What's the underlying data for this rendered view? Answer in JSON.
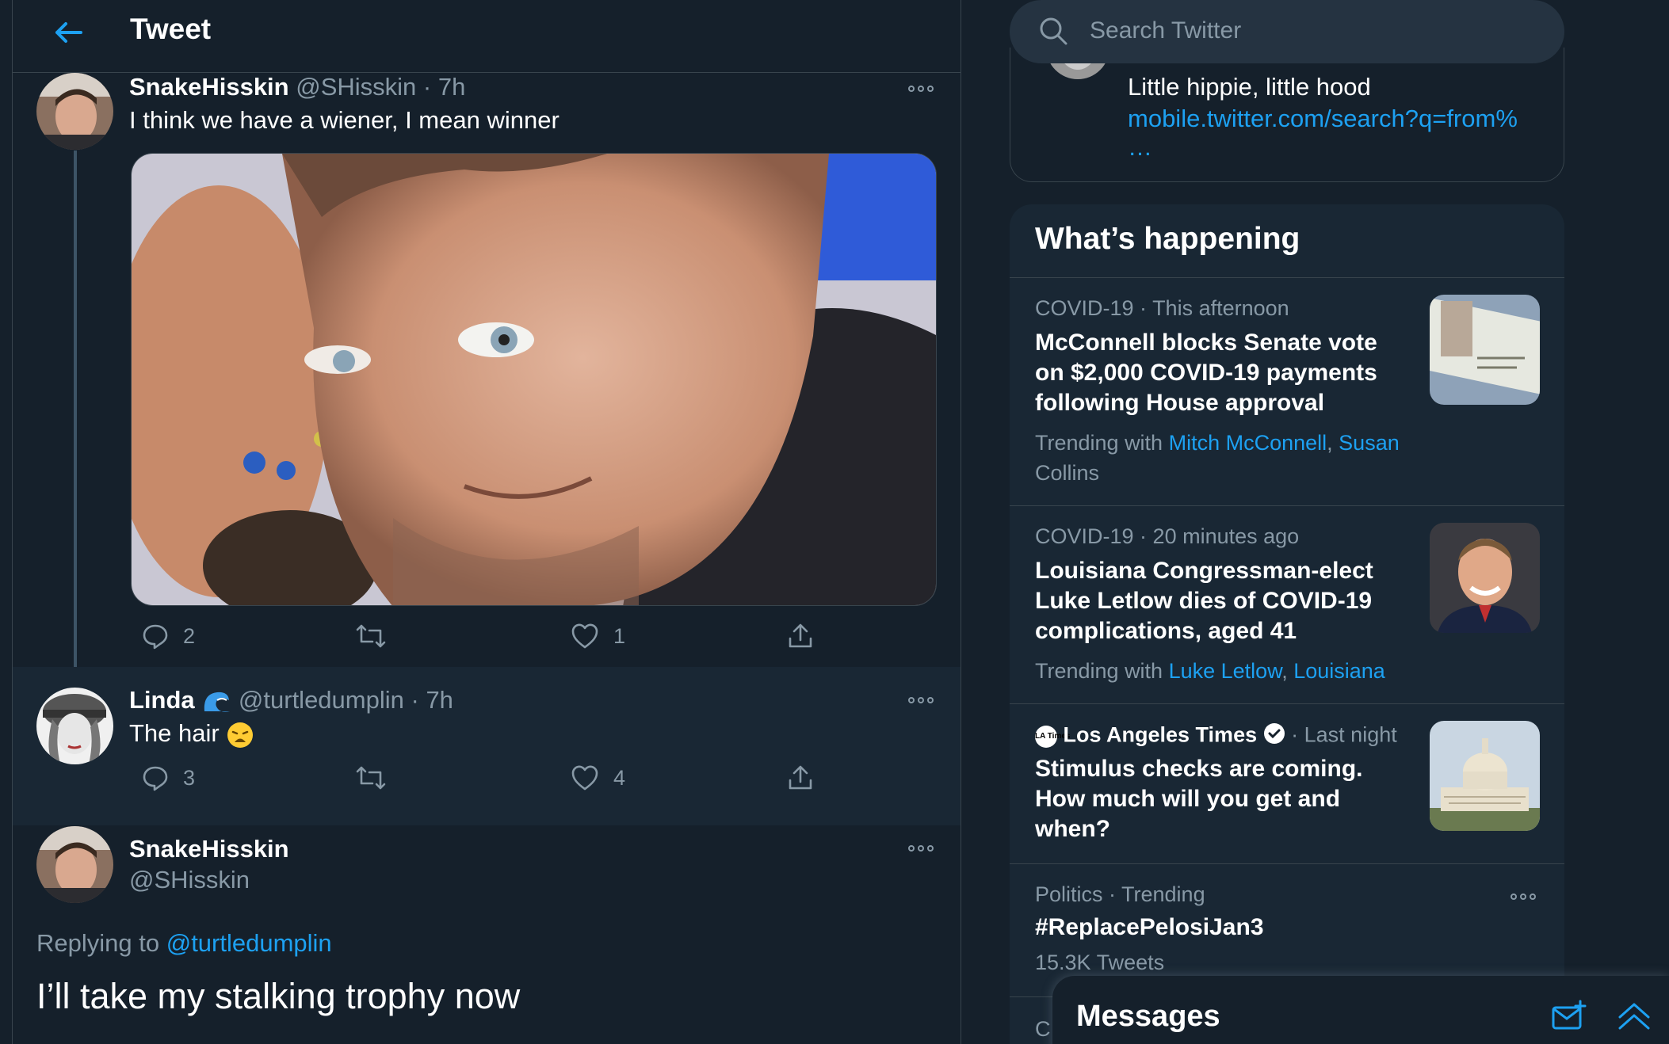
{
  "header": {
    "title": "Tweet"
  },
  "tweets": [
    {
      "name": "SnakeHisskin",
      "handle": "@SHisskin",
      "time": "7h",
      "text": "I think we have a wiener, I mean winner",
      "replies": "2",
      "likes": "1"
    },
    {
      "name": "Linda",
      "handle": "@turtledumplin",
      "time": "7h",
      "text": "The hair",
      "replies": "3",
      "likes": "4"
    }
  ],
  "main_tweet": {
    "name": "SnakeHisskin",
    "handle": "@SHisskin",
    "replying_prefix": "Replying to",
    "replying_to": "@turtledumplin",
    "text": "I’ll take my stalking trophy now"
  },
  "sep": " · ",
  "search": {
    "placeholder": "Search Twitter"
  },
  "prev_card": {
    "text": "Little hippie, little hood",
    "link": "mobile.twitter.com/search?q=from%",
    "ellipsis": "…"
  },
  "whats_happening": {
    "title": "What’s happening",
    "items": [
      {
        "category": "COVID-19",
        "time": "This afternoon",
        "headline_lines": [
          "McConnell blocks Senate vote",
          "on $2,000 COVID-19 payments",
          "following House approval"
        ],
        "trending_prefix": "Trending with",
        "trending_1": "Mitch McConnell",
        "trending_2a": "Susan",
        "trending_2b": "Collins"
      },
      {
        "category": "COVID-19",
        "time": "20 minutes ago",
        "headline_lines": [
          "Louisiana Congressman-elect",
          "Luke Letlow dies of COVID-19",
          "complications, aged 41"
        ],
        "trending_prefix": "Trending with",
        "trending_1": "Luke Letlow",
        "trending_2a": "Louisiana"
      },
      {
        "source": "Los Angeles Times",
        "source_logo": "LA Times",
        "time": "Last night",
        "headline_lines": [
          "Stimulus checks are coming.",
          "How much will you get and",
          "when?"
        ]
      },
      {
        "category": "Politics · Trending",
        "tag": "#ReplacePelosiJan3",
        "count": "15.3K Tweets"
      }
    ],
    "next_peek": "C"
  },
  "messages": {
    "title": "Messages"
  },
  "colors": {
    "background": "#15202b",
    "card": "#192734",
    "border": "#38444d",
    "accent": "#1da1f2",
    "muted": "#8899a6"
  },
  "icons": [
    "back-arrow-icon",
    "more-icon",
    "reply-icon",
    "retweet-icon",
    "like-icon",
    "share-icon",
    "search-icon",
    "verified-icon",
    "wave-emoji-icon",
    "weary-emoji-icon",
    "new-message-icon",
    "chevron-up-icon"
  ]
}
